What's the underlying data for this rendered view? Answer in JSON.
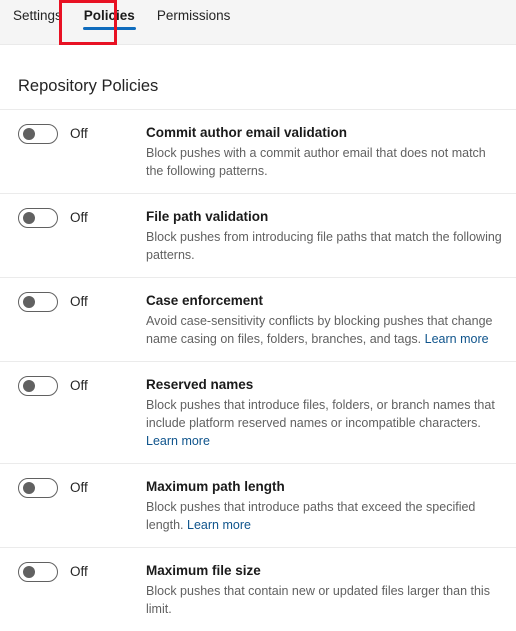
{
  "tabs": [
    {
      "label": "Settings",
      "selected": false
    },
    {
      "label": "Policies",
      "selected": true
    },
    {
      "label": "Permissions",
      "selected": false
    }
  ],
  "annotation": {
    "target_tab": "Policies",
    "color": "#e81123"
  },
  "accent_color": "#0f6cbd",
  "link_color": "#0f548c",
  "header": {
    "title": "Repository Policies"
  },
  "common": {
    "toggle_off_label": "Off",
    "learn_more_label": "Learn more"
  },
  "policies": [
    {
      "state_label": "Off",
      "enabled": false,
      "title": "Commit author email validation",
      "description": "Block pushes with a commit author email that does not match the following patterns.",
      "has_learn_more": false
    },
    {
      "state_label": "Off",
      "enabled": false,
      "title": "File path validation",
      "description": "Block pushes from introducing file paths that match the following patterns.",
      "has_learn_more": false
    },
    {
      "state_label": "Off",
      "enabled": false,
      "title": "Case enforcement",
      "description": "Avoid case-sensitivity conflicts by blocking pushes that change name casing on files, folders, branches, and tags.",
      "has_learn_more": true,
      "learn_more_label": "Learn more"
    },
    {
      "state_label": "Off",
      "enabled": false,
      "title": "Reserved names",
      "description": "Block pushes that introduce files, folders, or branch names that include platform reserved names or incompatible characters.",
      "has_learn_more": true,
      "learn_more_label": "Learn more"
    },
    {
      "state_label": "Off",
      "enabled": false,
      "title": "Maximum path length",
      "description": "Block pushes that introduce paths that exceed the specified length.",
      "has_learn_more": true,
      "learn_more_label": "Learn more"
    },
    {
      "state_label": "Off",
      "enabled": false,
      "title": "Maximum file size",
      "description": "Block pushes that contain new or updated files larger than this limit.",
      "has_learn_more": false
    }
  ]
}
